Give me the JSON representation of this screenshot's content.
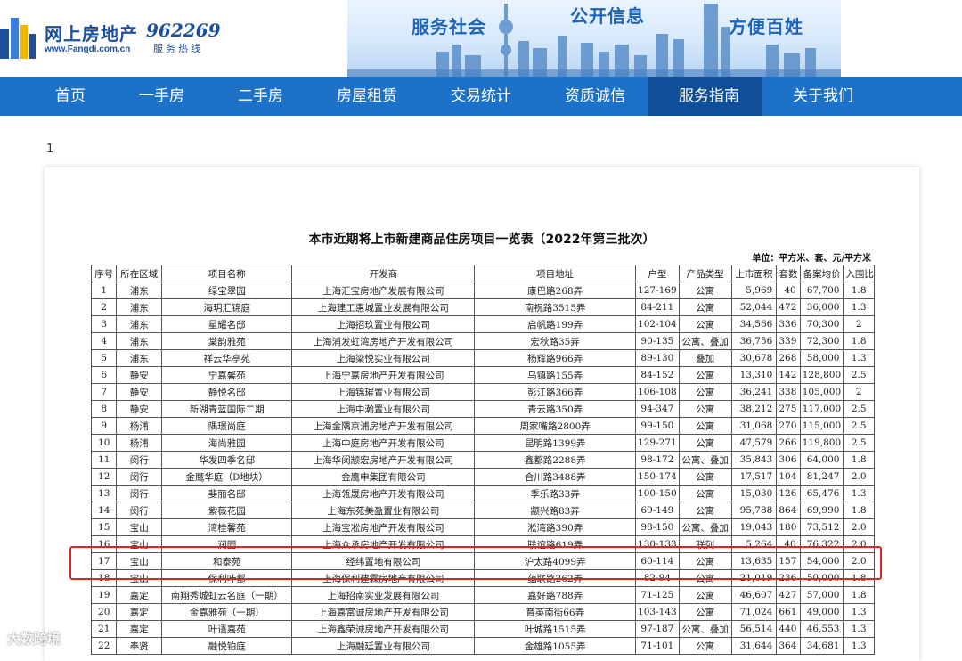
{
  "header": {
    "logo_name": "网上房地产",
    "logo_url": "www.Fangdi.com.cn",
    "hotline": "962269",
    "hotline_label": "服务热线",
    "slogans": [
      "服务社会",
      "公开信息",
      "方便百姓"
    ]
  },
  "nav": {
    "items": [
      "首页",
      "一手房",
      "二手房",
      "房屋租赁",
      "交易统计",
      "资质诚信",
      "服务指南",
      "关于我们"
    ],
    "active_index": 6
  },
  "page_number": "1",
  "doc": {
    "title": "本市近期将上市新建商品住房项目一览表（2022年第三批次）",
    "unit": "单位：平方米、套、元/平方米",
    "columns": [
      "序号",
      "所在区域",
      "项目名称",
      "开发商",
      "项目地址",
      "户型",
      "产品类型",
      "上市面积",
      "套数",
      "备案均价",
      "入围比"
    ],
    "rows": [
      [
        "1",
        "浦东",
        "绿宝翠园",
        "上海汇宝房地产发展有限公司",
        "康巴路268弄",
        "127-169",
        "公寓",
        "5,969",
        "40",
        "67,700",
        "1.8"
      ],
      [
        "2",
        "浦东",
        "海玥汇锦庭",
        "上海建工惠城置业发展有限公司",
        "南祝路3515弄",
        "84-211",
        "公寓",
        "52,044",
        "472",
        "36,000",
        "1.3"
      ],
      [
        "3",
        "浦东",
        "星耀名邸",
        "上海招玖置业有限公司",
        "启帆路199弄",
        "102-104",
        "公寓",
        "34,566",
        "336",
        "70,300",
        "2"
      ],
      [
        "4",
        "浦东",
        "棠韵雅苑",
        "上海浦发虹湾房地产开发有限公司",
        "宏秋路35弄",
        "90-135",
        "公寓、叠加",
        "36,756",
        "339",
        "72,300",
        "1.8"
      ],
      [
        "5",
        "浦东",
        "祥云华亭苑",
        "上海梁悦实业有限公司",
        "杨辉路966弄",
        "89-130",
        "叠加",
        "30,678",
        "268",
        "58,000",
        "1.3"
      ],
      [
        "6",
        "静安",
        "宁嘉馨苑",
        "上海宁嘉房地产开发有限公司",
        "乌镇路155弄",
        "84-152",
        "公寓",
        "13,310",
        "142",
        "128,800",
        "2.5"
      ],
      [
        "7",
        "静安",
        "静悦名邸",
        "上海锦璀置业有限公司",
        "彭江路366弄",
        "106-108",
        "公寓",
        "36,241",
        "338",
        "105,000",
        "2"
      ],
      [
        "8",
        "静安",
        "新湖青蓝国际二期",
        "上海中瀚置业有限公司",
        "青云路350弄",
        "94-347",
        "公寓",
        "38,212",
        "275",
        "117,000",
        "2.5"
      ],
      [
        "9",
        "杨浦",
        "隅璟尚庭",
        "上海金隅京浦房地产开发有限公司",
        "周家嘴路2800弄",
        "99-150",
        "公寓",
        "31,068",
        "270",
        "115,000",
        "2.5"
      ],
      [
        "10",
        "杨浦",
        "海尚雅园",
        "上海中庭房地产开发有限公司",
        "昆明路1399弄",
        "129-271",
        "公寓",
        "47,579",
        "266",
        "119,800",
        "2.5"
      ],
      [
        "11",
        "闵行",
        "华发四季名邸",
        "上海华闵颛宏房地产开发有限公司",
        "鑫都路2288弄",
        "98-172",
        "公寓、叠加",
        "35,843",
        "306",
        "64,000",
        "1.8"
      ],
      [
        "12",
        "闵行",
        "金鹰华庭（D地块）",
        "金鹰申集团有限公司",
        "合川路3488弄",
        "150-174",
        "公寓",
        "17,517",
        "104",
        "81,247",
        "2.0"
      ],
      [
        "13",
        "闵行",
        "斐丽名邸",
        "上海瓴晟房地产开发有限公司",
        "季乐路33弄",
        "100-150",
        "公寓",
        "15,030",
        "126",
        "65,476",
        "1.3"
      ],
      [
        "14",
        "闵行",
        "紫薇花园",
        "上海东苑美盈置业有限公司",
        "颛兴路83弄",
        "69-149",
        "公寓",
        "95,788",
        "864",
        "69,990",
        "1.8"
      ],
      [
        "15",
        "宝山",
        "湾桂馨苑",
        "上海宝凇房地产开发有限公司",
        "淞湾路390弄",
        "98-150",
        "公寓、叠加",
        "19,043",
        "180",
        "73,512",
        "2.0"
      ],
      [
        "16",
        "宝山",
        "润园",
        "上海众承房地产开发有限公司",
        "联谊路619弄",
        "130-133",
        "联列",
        "5,264",
        "40",
        "76,322",
        "2.0"
      ],
      [
        "17",
        "宝山",
        "和泰苑",
        "经纬置地有限公司",
        "沪太路4099弄",
        "60-114",
        "公寓",
        "13,635",
        "157",
        "54,000",
        "2.0"
      ],
      [
        "18",
        "宝山",
        "保利叶都",
        "上海保利建霖房地产有限公司",
        "蕴联路262弄",
        "82-94",
        "公寓",
        "21,019",
        "236",
        "50,000",
        "1.8"
      ],
      [
        "19",
        "嘉定",
        "南翔秀城虹云名庭（一期）",
        "上海招南实业发展有限公司",
        "嘉好路788弄",
        "71-125",
        "公寓",
        "46,607",
        "427",
        "57,000",
        "1.8"
      ],
      [
        "20",
        "嘉定",
        "金嘉雅苑（一期）",
        "上海嘉富诚房地产开发有限公司",
        "育英南街66弄",
        "103-143",
        "公寓",
        "71,024",
        "661",
        "49,000",
        "1.3"
      ],
      [
        "21",
        "嘉定",
        "叶语嘉苑",
        "上海鑫荣诚房地产开发有限公司",
        "叶城路1515弄",
        "97-187",
        "公寓、叠加",
        "56,514",
        "440",
        "46,553",
        "1.3"
      ],
      [
        "22",
        "奉贤",
        "融悦铂庭",
        "上海融廷置业有限公司",
        "金雄路1055弄",
        "71-101",
        "公寓",
        "31,644",
        "364",
        "34,681",
        "1.3"
      ]
    ]
  },
  "watermark": "大数跨境",
  "colors": {
    "nav_bg": "#1d72c7",
    "nav_active": "#0f4f99",
    "highlight": "#e02424",
    "brand": "#1c4f9c"
  }
}
